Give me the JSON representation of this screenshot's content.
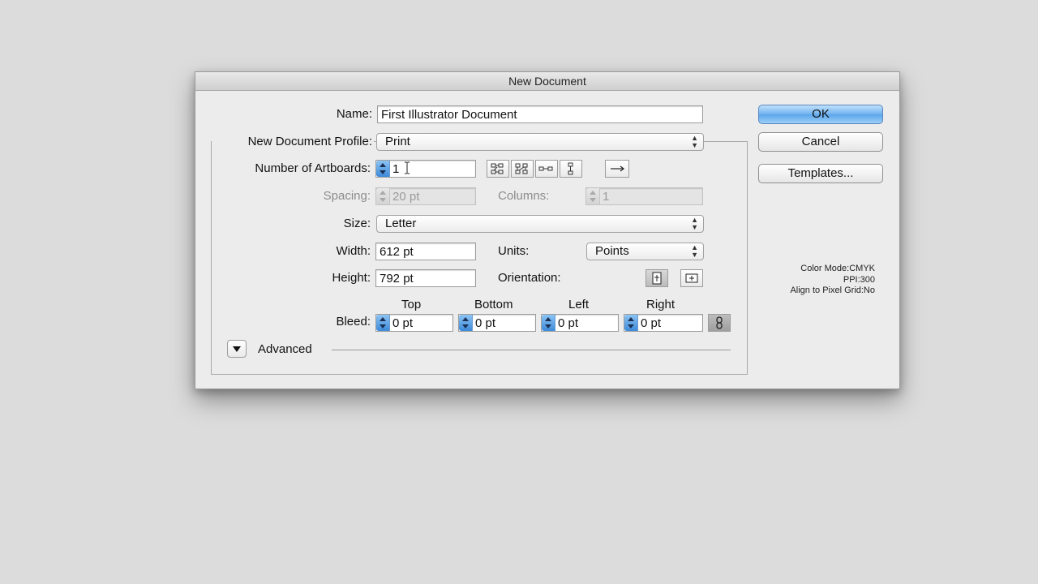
{
  "dialog": {
    "title": "New Document"
  },
  "name": {
    "label": "Name:",
    "value": "First Illustrator Document"
  },
  "profile": {
    "label": "New Document Profile:",
    "value": "Print"
  },
  "artboards": {
    "label": "Number of Artboards:",
    "value": "1"
  },
  "spacing": {
    "label": "Spacing:",
    "value": "20 pt"
  },
  "columns": {
    "label": "Columns:",
    "value": "1"
  },
  "size": {
    "label": "Size:",
    "value": "Letter"
  },
  "width": {
    "label": "Width:",
    "value": "612 pt"
  },
  "units": {
    "label": "Units:",
    "value": "Points"
  },
  "height": {
    "label": "Height:",
    "value": "792 pt"
  },
  "orientation": {
    "label": "Orientation:"
  },
  "bleed": {
    "label": "Bleed:",
    "top_label": "Top",
    "top_value": "0 pt",
    "bottom_label": "Bottom",
    "bottom_value": "0 pt",
    "left_label": "Left",
    "left_value": "0 pt",
    "right_label": "Right",
    "right_value": "0 pt"
  },
  "advanced": {
    "label": "Advanced"
  },
  "buttons": {
    "ok": "OK",
    "cancel": "Cancel",
    "templates": "Templates..."
  },
  "info": {
    "color_mode": "Color Mode:CMYK",
    "ppi": "PPI:300",
    "pixel_grid": "Align to Pixel Grid:No"
  },
  "colors": {
    "accent": "#5aa5ea",
    "background": "#dcdcdc",
    "dialog": "#ececec"
  }
}
